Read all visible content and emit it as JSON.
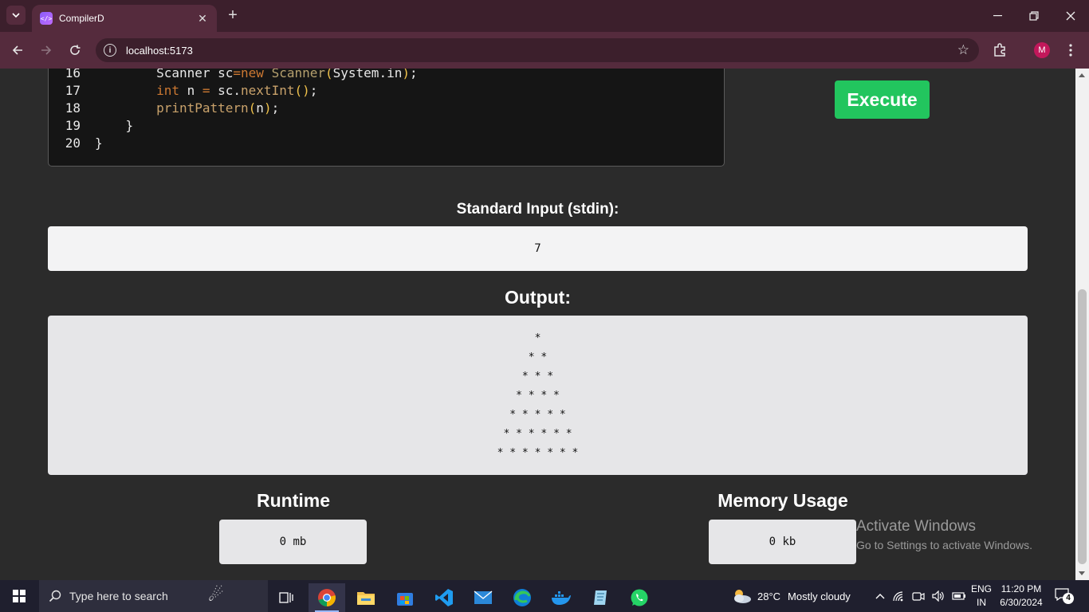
{
  "browser": {
    "tab_title": "CompilerD",
    "tab_favicon": "</>",
    "url": "localhost:5173",
    "profile_initial": "M"
  },
  "editor": {
    "lines": [
      {
        "number": "16",
        "tokens": [
          [
            "p",
            "        Scanner sc"
          ],
          [
            "o",
            "="
          ],
          [
            "k",
            "new "
          ],
          [
            "c",
            "Scanner"
          ],
          [
            "y",
            "("
          ],
          [
            "p",
            "System.in"
          ],
          [
            "y",
            ")"
          ],
          [
            "p",
            ";"
          ]
        ]
      },
      {
        "number": "17",
        "tokens": [
          [
            "k",
            "        int "
          ],
          [
            "p",
            "n "
          ],
          [
            "o",
            "= "
          ],
          [
            "p",
            "sc."
          ],
          [
            "f",
            "nextInt"
          ],
          [
            "y",
            "()"
          ],
          [
            "p",
            ";"
          ]
        ]
      },
      {
        "number": "18",
        "tokens": [
          [
            "f",
            "        printPattern"
          ],
          [
            "y",
            "("
          ],
          [
            "p",
            "n"
          ],
          [
            "y",
            ")"
          ],
          [
            "p",
            ";"
          ]
        ]
      },
      {
        "number": "19",
        "tokens": [
          [
            "p",
            "    }"
          ]
        ]
      },
      {
        "number": "20",
        "tokens": [
          [
            "p",
            "}"
          ]
        ]
      }
    ]
  },
  "actions": {
    "execute_label": "Execute"
  },
  "stdin": {
    "label": "Standard Input (stdin):",
    "value": "7"
  },
  "output": {
    "label": "Output:",
    "lines": [
      "*",
      "* *",
      "* * *",
      "* * * *",
      "* * * * *",
      "* * * * * *",
      "* * * * * * *"
    ]
  },
  "metrics": {
    "runtime_label": "Runtime",
    "runtime_value": "0 mb",
    "memory_label": "Memory Usage",
    "memory_value": "0 kb"
  },
  "watermark": {
    "title": "Activate Windows",
    "subtitle": "Go to Settings to activate Windows."
  },
  "taskbar": {
    "search_placeholder": "Type here to search",
    "weather_temp": "28°C",
    "weather_desc": "Mostly cloudy",
    "lang_line1": "ENG",
    "lang_line2": "IN",
    "time": "11:20 PM",
    "date": "6/30/2024",
    "notification_count": "4"
  },
  "colors": {
    "execute_button": "#22c55e",
    "tab_bar": "#3c1f2c",
    "toolbar": "#552b3d",
    "page_bg": "#2b2b2b"
  }
}
